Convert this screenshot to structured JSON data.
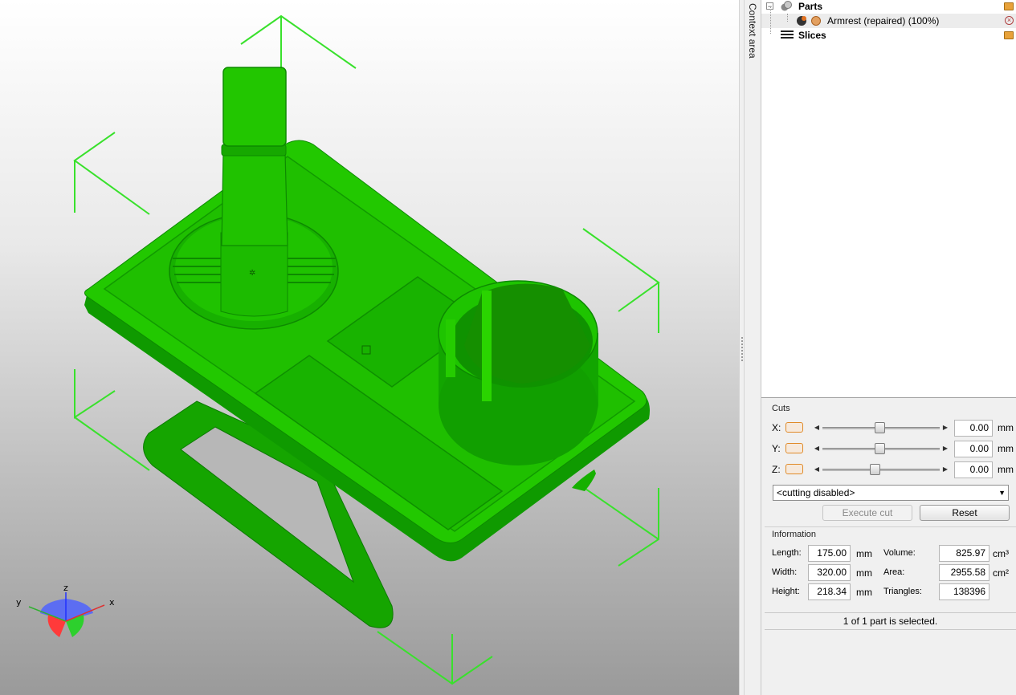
{
  "sidebar": {
    "context_label": "Context area"
  },
  "tree": {
    "parts_label": "Parts",
    "part_item_label": "Armrest (repaired) (100%)",
    "slices_label": "Slices"
  },
  "cuts": {
    "title": "Cuts",
    "x_label": "X:",
    "y_label": "Y:",
    "z_label": "Z:",
    "x_value": "0.00",
    "y_value": "0.00",
    "z_value": "0.00",
    "unit": "mm",
    "mode_selected": "<cutting disabled>",
    "execute_label": "Execute cut",
    "reset_label": "Reset"
  },
  "information": {
    "title": "Information",
    "length_label": "Length:",
    "length_value": "175.00",
    "width_label": "Width:",
    "width_value": "320.00",
    "height_label": "Height:",
    "height_value": "218.34",
    "length_unit": "mm",
    "volume_label": "Volume:",
    "volume_value": "825.97",
    "volume_unit": "cm³",
    "area_label": "Area:",
    "area_value": "2955.58",
    "area_unit": "cm²",
    "triangles_label": "Triangles:",
    "triangles_value": "138396"
  },
  "status": {
    "selection_text": "1 of 1 part is selected."
  },
  "gizmo": {
    "x_label": "x",
    "y_label": "y",
    "z_label": "z"
  },
  "colors": {
    "model_green": "#1fc400",
    "bbox_green": "#33e02a",
    "accent_orange": "#e08a28"
  }
}
